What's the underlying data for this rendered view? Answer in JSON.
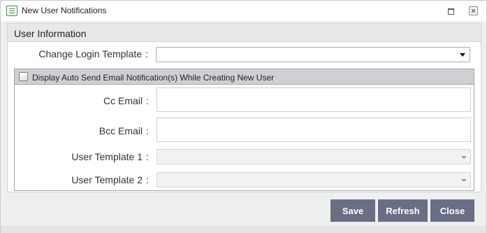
{
  "window": {
    "title": "New User Notifications",
    "icons": {
      "app": "notifications-list-icon",
      "maximize": "maximize-icon",
      "close": "close-icon"
    }
  },
  "panel": {
    "title": "User Information",
    "login_template": {
      "label": "Change Login Template",
      "colon": ":",
      "value": ""
    },
    "auto_send": {
      "checked": false,
      "label": "Display Auto Send Email Notification(s) While Creating New User",
      "cc_email": {
        "label": "Cc Email",
        "colon": ":",
        "value": ""
      },
      "bcc_email": {
        "label": "Bcc Email",
        "colon": ":",
        "value": ""
      },
      "user_template_1": {
        "label": "User Template 1",
        "colon": ":",
        "value": "",
        "disabled": true
      },
      "user_template_2": {
        "label": "User Template 2",
        "colon": ":",
        "value": "",
        "disabled": true
      }
    }
  },
  "buttons": {
    "save": "Save",
    "refresh": "Refresh",
    "close": "Close"
  },
  "colors": {
    "button_bg": "#6a6e85",
    "header_bg": "#e8e8e8",
    "subheader_bg": "#cfd0d4"
  }
}
